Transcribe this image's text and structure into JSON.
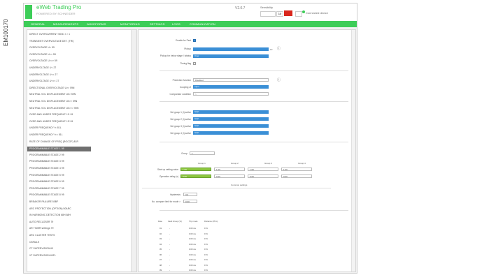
{
  "figure_id": "EM100170",
  "app": {
    "title": "eWeb Trading Pro",
    "subtitle": "POWERED BY SCHNEIDER",
    "version": "V2.0.7"
  },
  "toolbar": {
    "label_right": "Sensibility",
    "value_box": "10",
    "status_text": "Connected device"
  },
  "menu": [
    "GENERAL",
    "MEASUREMENTS",
    "WAVEFORMS",
    "MONITORING",
    "SETTINGS",
    "LOGS",
    "COMMUNICATION"
  ],
  "tree": [
    {
      "label": "DIRECT OVERCURRENT 50/51 I > 1",
      "selected": false
    },
    {
      "label": "TRANSIENT OVERVOLTAGE DET. (TRI)",
      "selected": false
    },
    {
      "label": "OVERVOLTAGE U>     59",
      "selected": false
    },
    {
      "label": "OVERVOLTAGE U>>    59",
      "selected": false
    },
    {
      "label": "OVERVOLTAGE U>>>   59",
      "selected": false
    },
    {
      "label": "UNDERVOLTAGE U<    27",
      "selected": false
    },
    {
      "label": "UNDERVOLTAGE U<<   27",
      "selected": false
    },
    {
      "label": "UNDERVOLTAGE U<<<  27",
      "selected": false
    },
    {
      "label": "DIRECTIONAL OVERVOLTAGE U>>   59N",
      "selected": false
    },
    {
      "label": "NEUTRAL VOL DISPLACEMENT U0>  59N",
      "selected": false
    },
    {
      "label": "NEUTRAL VOL DISPLACEMENT U0>> 59N",
      "selected": false
    },
    {
      "label": "NEUTRAL VOL DISPLACEMENT U0>>> 59N",
      "selected": false
    },
    {
      "label": "OVER AND UNDER FREQUENCY f1   81",
      "selected": false
    },
    {
      "label": "OVER AND UNDER FREQUENCY f2   81",
      "selected": false
    },
    {
      "label": "UNDER FREQUENCY f<   81L",
      "selected": false
    },
    {
      "label": "UNDER FREQUENCY f<<  81L",
      "selected": false
    },
    {
      "label": "RATE OF CHANGE OF FREQ (ROCOF) 81R",
      "selected": false
    },
    {
      "label": "PROGRAMMABLE STAGE 1     99",
      "selected": true
    },
    {
      "label": "PROGRAMMABLE STAGE 2     99",
      "selected": false
    },
    {
      "label": "PROGRAMMABLE STAGE 3     99",
      "selected": false
    },
    {
      "label": "PROGRAMMABLE STAGE 4     99",
      "selected": false
    },
    {
      "label": "PROGRAMMABLE STAGE 5     99",
      "selected": false
    },
    {
      "label": "PROGRAMMABLE STAGE 6     99",
      "selected": false
    },
    {
      "label": "PROGRAMMABLE STAGE 7     99",
      "selected": false
    },
    {
      "label": "PROGRAMMABLE STAGE 8     99",
      "selected": false
    },
    {
      "label": "BREAKER FAILURE      50BF",
      "selected": false
    },
    {
      "label": "ARC PROTECTION (OPTION) 50ARC",
      "selected": false
    },
    {
      "label": "IN HARMONIC DETECTION 68H 68H",
      "selected": false
    },
    {
      "label": "AUTO RECLOSER   79",
      "selected": false
    },
    {
      "label": "AR TIMER settings   79",
      "selected": false
    },
    {
      "label": "ARC CLUSTER TESTS",
      "selected": false
    },
    {
      "label": "CBFAILE",
      "selected": false
    },
    {
      "label": "CT SUPERVISION    60",
      "selected": false
    },
    {
      "label": "VT SUPERVISION    60FL",
      "selected": false
    }
  ],
  "settings": {
    "enable_label": "Enable for Pset",
    "pickup_label": "Pickup",
    "pickup_unit": "Hz",
    "pickup_info_icon": "info-icon",
    "pt_label": "Pickup for below stage / Istatus",
    "pt_value": "Over",
    "timing_label": "Timing flag",
    "prot_func_label": "Protection function",
    "prot_func_value": "Disabled",
    "prot_info_icon": "info-icon",
    "coupling_label": "Coupling of",
    "coupling_value": "Input",
    "comparator_label": "Comparator condition",
    "comparator_value": ">",
    "grp_labels": [
      "Set group 1 (I) active",
      "Set group 2 (I) active",
      "Set group 3 (I) active",
      "Set group 4 (I) active"
    ],
    "grp_value": "Start",
    "group_label": "Group",
    "group_value": "1",
    "group_headers": [
      "Group 1",
      "Group 2",
      "Group 3",
      "Group 4"
    ],
    "row1_label": "Start up setting value",
    "row1_values": [
      "1.00",
      "1.00",
      "1.00",
      "1.00"
    ],
    "row2_label": "Operation delay (s)",
    "row2_values": [
      "0.00",
      "0.00",
      "0.00",
      "0.00"
    ],
    "section_label": "Common settings",
    "hysteresis_label": "Hysteresis",
    "hysteresis_value": "3.0",
    "nocompare_label": "No. compare limit for mode >",
    "nocompare_value": "0.00"
  },
  "event_table": {
    "headers": [
      "Date",
      "Fault Group (%)",
      "Trip mode",
      "Distance (Phm)"
    ],
    "rows": [
      [
        "01",
        "-",
        "0.00 ms",
        "0 %"
      ],
      [
        "02",
        "-",
        "0.00 ms",
        "0 %"
      ],
      [
        "03",
        "-",
        "0.00 ms",
        "0 %"
      ],
      [
        "04",
        "-",
        "0.00 ms",
        "0 %"
      ],
      [
        "05",
        "-",
        "0.00 ms",
        "0 %"
      ],
      [
        "06",
        "-",
        "0.00 ms",
        "0 %"
      ],
      [
        "07",
        "-",
        "0.00 ms",
        "0 %"
      ],
      [
        "08",
        "-",
        "0.00 ms",
        "0 %"
      ],
      [
        "09",
        "-",
        "0.00 ms",
        "0 %"
      ]
    ]
  },
  "colors": {
    "brand": "#3dcd58",
    "accent": "#3a8fd6",
    "selected": "#6f6f6f",
    "green_cell": "#8cc63f",
    "red_button": "#d9261c"
  }
}
